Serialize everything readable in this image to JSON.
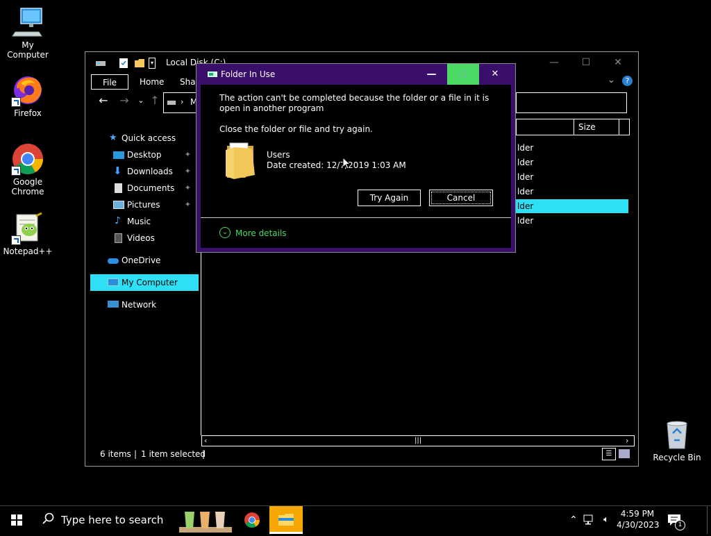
{
  "desktop": {
    "icons": [
      {
        "label": "My Computer",
        "icon": "computer-icon"
      },
      {
        "label": "Firefox",
        "icon": "firefox-icon"
      },
      {
        "label": "Google Chrome",
        "icon": "chrome-icon"
      },
      {
        "label": "Notepad++",
        "icon": "notepadpp-icon"
      },
      {
        "label": "Recycle Bin",
        "icon": "recycle-bin-icon"
      }
    ]
  },
  "explorer": {
    "title": "Local Disk (C:)",
    "tabs": [
      "File",
      "Home",
      "Shar"
    ],
    "address_text": "M",
    "nav": {
      "quick_access": "Quick access",
      "items": [
        {
          "label": "Desktop",
          "icon": "desktop-folder-icon"
        },
        {
          "label": "Downloads",
          "icon": "downloads-icon"
        },
        {
          "label": "Documents",
          "icon": "documents-icon"
        },
        {
          "label": "Pictures",
          "icon": "pictures-icon"
        },
        {
          "label": "Music",
          "icon": "music-icon"
        },
        {
          "label": "Videos",
          "icon": "videos-icon"
        }
      ],
      "onedrive": "OneDrive",
      "my_computer": "My Computer",
      "network": "Network"
    },
    "columns": {
      "size": "Size"
    },
    "rows": [
      "lder",
      "lder",
      "lder",
      "lder",
      "lder",
      "lder"
    ],
    "selected_row": 4,
    "status": {
      "items": "6 items",
      "selected": "1 item selected"
    }
  },
  "dialog": {
    "title": "Folder In Use",
    "message": "The action can't be completed because the folder or a file in it is open in another program",
    "instruction": "Close the folder or file and try again.",
    "item_name": "Users",
    "item_date": "Date created: 12/7/2019 1:03 AM",
    "try_again": "Try Again",
    "cancel": "Cancel",
    "more_details": "More details",
    "accent": "#3a0e6b",
    "maximize_color": "#4cd964"
  },
  "taskbar": {
    "search_placeholder": "Type here to search",
    "time": "4:59 PM",
    "date": "4/30/2023",
    "notification_count": "1"
  }
}
